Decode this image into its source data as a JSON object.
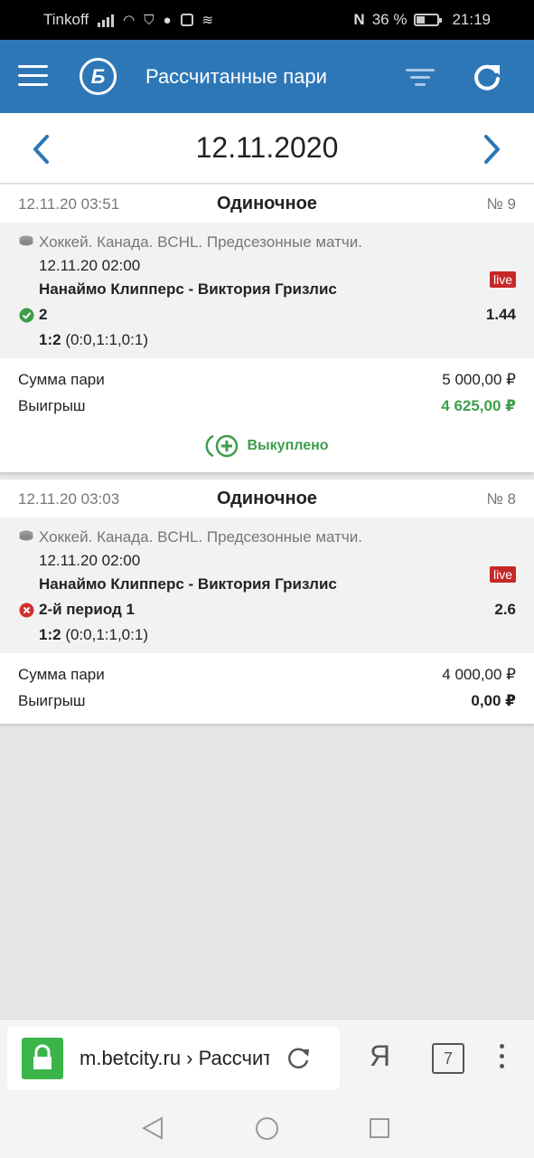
{
  "status_bar": {
    "carrier": "Tinkoff",
    "nfc_badge": "N",
    "battery": "36 %",
    "time": "21:19"
  },
  "header": {
    "logo_letter": "Б",
    "title": "Рассчитанные пари"
  },
  "date_nav": {
    "date": "12.11.2020"
  },
  "bets": [
    {
      "placed": "12.11.20 03:51",
      "type": "Одиночное",
      "number": "№ 9",
      "league": "Хоккей. Канада. BCHL. Предсезонные матчи.",
      "event_time": "12.11.20 02:00",
      "teams": "Нанаймо Клипперс - Виктория Гризлис",
      "live": "live",
      "pick": "2",
      "odds": "1.44",
      "score_main": "1:2",
      "score_periods": "(0:0,1:1,0:1)",
      "stake_label": "Сумма пари",
      "stake": "5 000,00 ₽",
      "win_label": "Выигрыш",
      "win": "4 625,00 ₽",
      "status": "won",
      "cashout": "Выкуплено"
    },
    {
      "placed": "12.11.20 03:03",
      "type": "Одиночное",
      "number": "№ 8",
      "league": "Хоккей. Канада. BCHL. Предсезонные матчи.",
      "event_time": "12.11.20 02:00",
      "teams": "Нанаймо Клипперс - Виктория Гризлис",
      "live": "live",
      "pick": "2-й период 1",
      "odds": "2.6",
      "score_main": "1:2",
      "score_periods": "(0:0,1:1,0:1)",
      "stake_label": "Сумма пари",
      "stake": "4 000,00 ₽",
      "win_label": "Выигрыш",
      "win": "0,00 ₽",
      "status": "lost"
    }
  ],
  "browser": {
    "url": "m.betcity.ru › Рассчитанные пари",
    "yandex_letter": "Я",
    "tab_count": "7"
  },
  "colors": {
    "brand_blue": "#2e77b7",
    "win_green": "#3f9d4b",
    "lost_red": "#d32f2f",
    "live_red": "#c62828"
  }
}
